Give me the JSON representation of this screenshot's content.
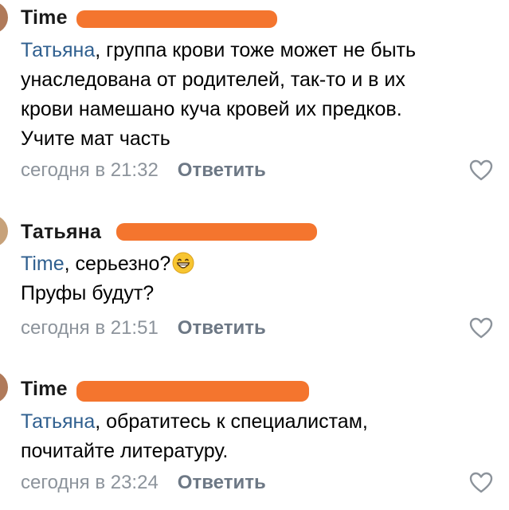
{
  "comments": [
    {
      "author": "Time",
      "mention": "Татьяна",
      "text_lines": [
        ", группа крови тоже может не быть",
        "унаследована от родителей, так-то и в их",
        "крови намешано куча кровей их предков.",
        "Учите мат часть"
      ],
      "timestamp": "сегодня в 21:32",
      "reply_label": "Ответить"
    },
    {
      "author": "Татьяна",
      "mention": "Time",
      "text_lines": [
        ", серьезно?",
        "Пруфы будут?"
      ],
      "timestamp": "сегодня в 21:51",
      "reply_label": "Ответить"
    },
    {
      "author": "Time",
      "mention": "Татьяна",
      "text_lines": [
        ", обратитесь к специалистам,",
        "почитайте литературу."
      ],
      "timestamp": "сегодня в 23:24",
      "reply_label": "Ответить"
    }
  ],
  "colors": {
    "mention": "#2f5f8f",
    "redaction": "#f4752e",
    "meta": "#8c939b"
  },
  "icons": {
    "like": "heart-outline-icon",
    "emoji": "grinning-face-icon"
  }
}
